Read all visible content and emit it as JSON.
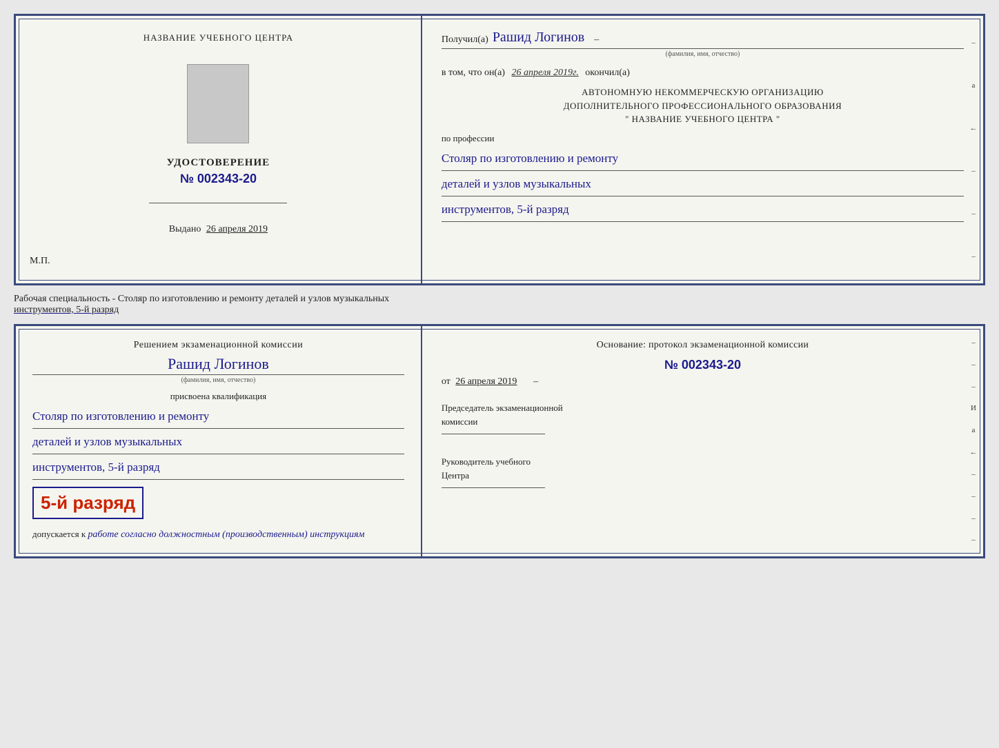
{
  "top_cert": {
    "left": {
      "school_name": "НАЗВАНИЕ УЧЕБНОГО ЦЕНТРА",
      "udostoverenie": "УДОСТОВЕРЕНИЕ",
      "number": "№ 002343-20",
      "vydano_label": "Выдано",
      "vydano_date": "26 апреля 2019",
      "mp": "М.П."
    },
    "right": {
      "poluchil_label": "Получил(а)",
      "name_handwritten": "Рашид Логинов",
      "fio_sublabel": "(фамилия, имя, отчество)",
      "dash": "–",
      "vtom_prefix": "в том, что он(а)",
      "date_handwritten": "26 апреля 2019г.",
      "okončil_label": "окончил(а)",
      "org_line1": "АВТОНОМНУЮ НЕКОММЕРЧЕСКУЮ ОРГАНИЗАЦИЮ",
      "org_line2": "ДОПОЛНИТЕЛЬНОГО ПРОФЕССИОНАЛЬНОГО ОБРАЗОВАНИЯ",
      "org_line3": "\"   НАЗВАНИЕ УЧЕБНОГО ЦЕНТРА   \"",
      "po_professii": "по профессии",
      "profession_line1": "Столяр по изготовлению и ремонту",
      "profession_line2": "деталей и узлов музыкальных",
      "profession_line3": "инструментов, 5-й разряд",
      "side_chars": [
        "–",
        "a",
        "←",
        "–",
        "–",
        "–"
      ]
    }
  },
  "middle": {
    "text_prefix": "Рабочая специальность - Столяр по изготовлению и ремонту деталей и узлов музыкальных",
    "text_line2": "инструментов, 5-й разряд"
  },
  "bottom_cert": {
    "left": {
      "resheniem": "Решением экзаменационной комиссии",
      "name_handwritten": "Рашид Логинов",
      "fio_sublabel": "(фамилия, имя, отчество)",
      "prisvoena": "присвоена квалификация",
      "profession_line1": "Столяр по изготовлению и ремонту",
      "profession_line2": "деталей и узлов музыкальных",
      "profession_line3": "инструментов, 5-й разряд",
      "rank_badge": "5-й разряд",
      "dopuskaetsya_prefix": "допускается к",
      "dopuskaetsya_italic": "работе согласно должностным (производственным) инструкциям"
    },
    "right": {
      "osnovanie": "Основание: протокол экзаменационной комиссии",
      "protocol_number": "№  002343-20",
      "ot_prefix": "от",
      "ot_date": "26 апреля 2019",
      "chairman_line1": "Председатель экзаменационной",
      "chairman_line2": "комиссии",
      "rukovoditel_line1": "Руководитель учебного",
      "rukovoditel_line2": "Центра",
      "side_chars": [
        "–",
        "–",
        "–",
        "И",
        "а",
        "←",
        "–",
        "–",
        "–",
        "–"
      ]
    }
  }
}
